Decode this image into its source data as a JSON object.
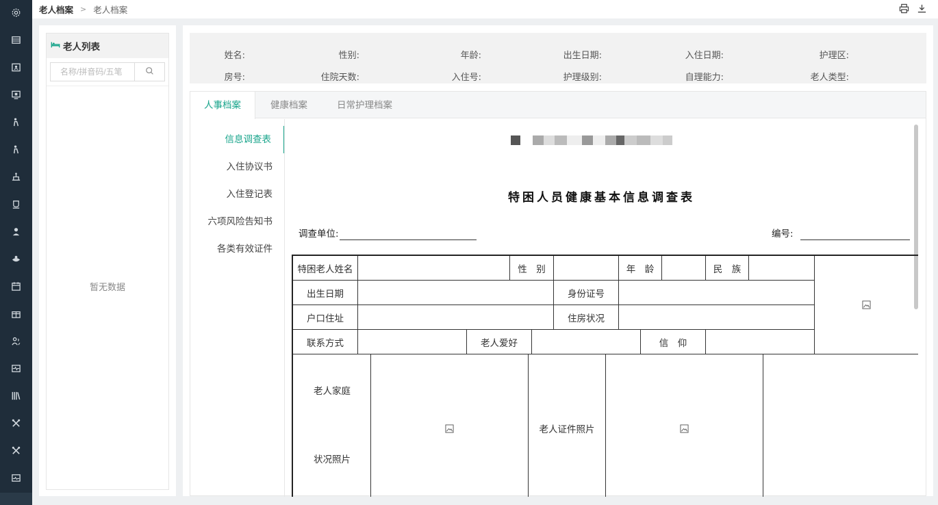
{
  "breadcrumb": {
    "root": "老人档案",
    "current": "老人档案"
  },
  "sidebar": {
    "items": [
      {
        "icon": "settings-icon"
      },
      {
        "icon": "layout-icon"
      },
      {
        "icon": "user-card-icon"
      },
      {
        "icon": "monitor-icon"
      },
      {
        "icon": "elder-icon"
      },
      {
        "icon": "elder-alt-icon"
      },
      {
        "icon": "house-icon"
      },
      {
        "icon": "cup-icon"
      },
      {
        "icon": "nurse-icon"
      },
      {
        "icon": "hand-icon"
      },
      {
        "icon": "calendar-icon"
      },
      {
        "icon": "gift-icon"
      },
      {
        "icon": "users-icon"
      },
      {
        "icon": "pulse-icon"
      },
      {
        "icon": "library-icon"
      },
      {
        "icon": "tools-icon"
      },
      {
        "icon": "tools-alt-icon"
      },
      {
        "icon": "pulse-alt-icon"
      }
    ]
  },
  "elder_list": {
    "title": "老人列表",
    "search_placeholder": "名称/拼音码/五笔",
    "empty_text": "暂无数据"
  },
  "info": {
    "row1": [
      "姓名:",
      "性别:",
      "年龄:",
      "出生日期:",
      "入住日期:",
      "护理区:"
    ],
    "row2": [
      "房号:",
      "住院天数:",
      "入住号:",
      "护理级别:",
      "自理能力:",
      "老人类型:"
    ]
  },
  "tabs": [
    "人事档案",
    "健康档案",
    "日常护理档案"
  ],
  "subnav": [
    "信息调查表",
    "入住协议书",
    "入住登记表",
    "六项风险告知书",
    "各类有效证件"
  ],
  "doc": {
    "title": "特困人员健康基本信息调查表",
    "unit_label": "调查单位:",
    "number_label": "编号:",
    "table": {
      "name_label": "特困老人姓名",
      "gender_label": "性　别",
      "age_label": "年　龄",
      "ethnic_label": "民　族",
      "birth_label": "出生日期",
      "id_label": "身份证号",
      "hukou_label": "户口住址",
      "housing_label": "住房状况",
      "contact_label": "联系方式",
      "hobby_label": "老人爱好",
      "belief_label": "信　仰",
      "family_label_1": "老人家庭",
      "family_label_2": "状况照片",
      "cert_label": "老人证件照片"
    }
  },
  "colors": {
    "accent": "#1aa58c",
    "rail": "#1f2d3a"
  }
}
